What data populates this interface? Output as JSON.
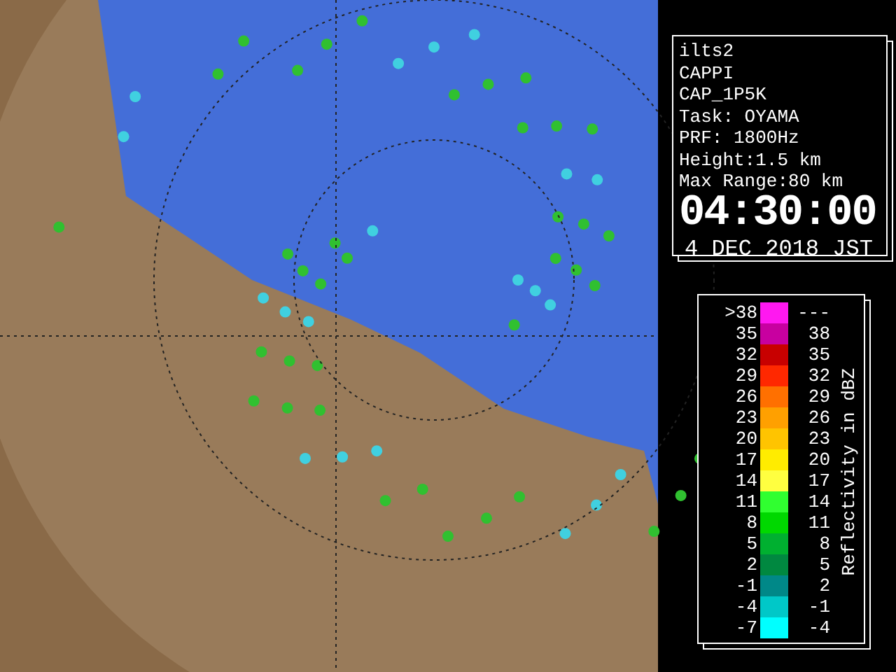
{
  "info": {
    "lines": [
      "ilts2",
      "CAPPI",
      "CAP_1P5K",
      "Task: OYAMA",
      "PRF: 1800Hz",
      "Height:1.5 km",
      "Max Range:80 km"
    ],
    "time": "04:30:00",
    "date": "4 DEC 2018 JST"
  },
  "legend": {
    "title": "Reflectivity in dBZ",
    "rows": [
      {
        "low": ">38",
        "high": "---",
        "color": "#ff18f0"
      },
      {
        "low": "35",
        "high": "38",
        "color": "#c800a0"
      },
      {
        "low": "32",
        "high": "35",
        "color": "#c80000"
      },
      {
        "low": "29",
        "high": "32",
        "color": "#ff2800"
      },
      {
        "low": "26",
        "high": "29",
        "color": "#ff7000"
      },
      {
        "low": "23",
        "high": "26",
        "color": "#ffa000"
      },
      {
        "low": "20",
        "high": "23",
        "color": "#ffc400"
      },
      {
        "low": "17",
        "high": "20",
        "color": "#ffec00"
      },
      {
        "low": "14",
        "high": "17",
        "color": "#ffff40"
      },
      {
        "low": "11",
        "high": "14",
        "color": "#30ff30"
      },
      {
        "low": "8",
        "high": "11",
        "color": "#00d800"
      },
      {
        "low": "5",
        "high": "8",
        "color": "#00b030"
      },
      {
        "low": "2",
        "high": "5",
        "color": "#008840"
      },
      {
        "low": "-1",
        "high": "2",
        "color": "#008888"
      },
      {
        "low": "-4",
        "high": "-1",
        "color": "#00c8c8"
      },
      {
        "low": "-7",
        "high": "-4",
        "color": "#00ffff"
      }
    ]
  }
}
